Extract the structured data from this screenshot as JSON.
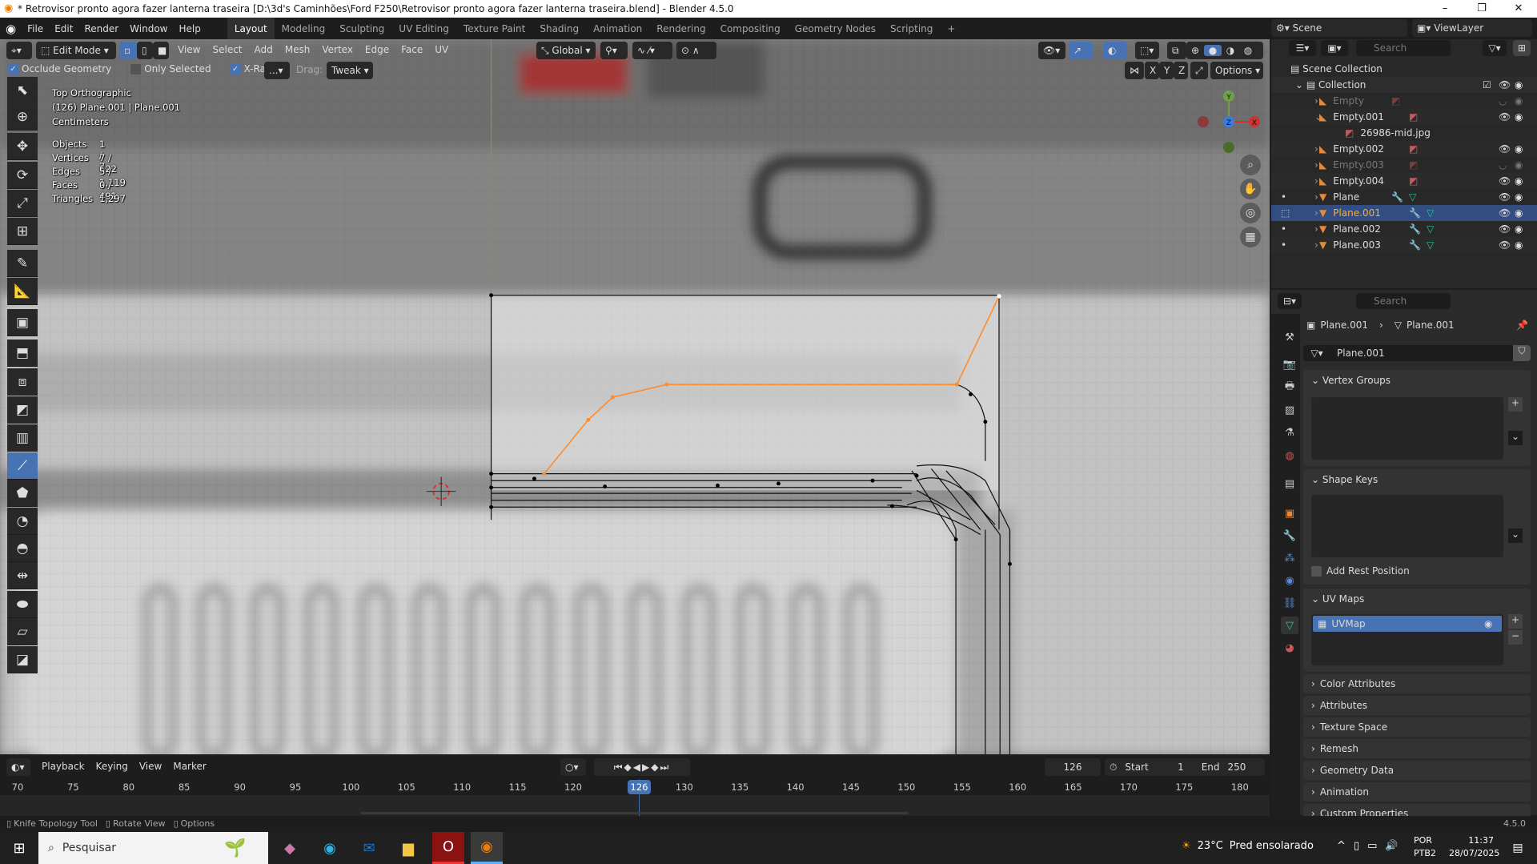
{
  "window": {
    "title": "* Retrovisor pronto agora fazer lanterna traseira [D:\\3d's Caminhões\\Ford F250\\Retrovisor pronto agora fazer lanterna traseira.blend] - Blender 4.5.0",
    "minimize": "–",
    "maximize": "❐",
    "close": "✕"
  },
  "menu": [
    "File",
    "Edit",
    "Render",
    "Window",
    "Help"
  ],
  "workspaces": [
    "Layout",
    "Modeling",
    "Sculpting",
    "UV Editing",
    "Texture Paint",
    "Shading",
    "Animation",
    "Rendering",
    "Compositing",
    "Geometry Nodes",
    "Scripting",
    "+"
  ],
  "active_workspace": "Layout",
  "scene": {
    "name": "Scene",
    "view_layer": "ViewLayer"
  },
  "viewport": {
    "mode": "Edit Mode",
    "menus": [
      "View",
      "Select",
      "Add",
      "Mesh",
      "Vertex",
      "Edge",
      "Face",
      "UV"
    ],
    "orientation": "Global",
    "options": {
      "occlude_geometry": "Occlude Geometry",
      "occlude_checked": true,
      "only_selected": "Only Selected",
      "only_selected_checked": false,
      "xray": "X-Ray",
      "xray_checked": true,
      "more": "...",
      "drag_label": "Drag:",
      "drag_value": "Tweak"
    },
    "mirror_axes": [
      "X",
      "Y",
      "Z"
    ],
    "options_btn": "Options",
    "overlay": {
      "view": "Top Orthographic",
      "object": "(126) Plane.001 | Plane.001",
      "units": "Centimeters"
    },
    "stats": [
      {
        "label": "Objects",
        "value": "1 / 7"
      },
      {
        "label": "Vertices",
        "value": "7 / 622"
      },
      {
        "label": "Edges",
        "value": "5 / 1,119"
      },
      {
        "label": "Faces",
        "value": "0 / 491"
      },
      {
        "label": "Triangles",
        "value": "1,297"
      }
    ],
    "gizmo": {
      "y": "Y",
      "x": "X",
      "z": "Z"
    },
    "accent": "#4772b3",
    "edge_selected": "#ff8c2a"
  },
  "tools": [
    "select-box",
    "cursor",
    "move",
    "rotate",
    "scale",
    "transform",
    "annotate",
    "measure",
    "add-cube",
    "extrude",
    "inset",
    "bevel",
    "loop-cut",
    "knife",
    "poly-build",
    "spin",
    "smooth",
    "edge-slide",
    "shrink-fatten",
    "shear",
    "rip"
  ],
  "active_tool": "knife",
  "outliner": {
    "search_placeholder": "Search",
    "scene_collection": "Scene Collection",
    "collection": "Collection",
    "items": [
      {
        "name": "Empty",
        "type": "empty",
        "hidden": true
      },
      {
        "name": "Empty.001",
        "type": "empty",
        "expanded": true
      },
      {
        "name": "26986-mid.jpg",
        "type": "image",
        "child": true
      },
      {
        "name": "Empty.002",
        "type": "empty"
      },
      {
        "name": "Empty.003",
        "type": "empty",
        "hidden": true
      },
      {
        "name": "Empty.004",
        "type": "empty"
      },
      {
        "name": "Plane",
        "type": "mesh"
      },
      {
        "name": "Plane.001",
        "type": "mesh",
        "selected": true
      },
      {
        "name": "Plane.002",
        "type": "mesh"
      },
      {
        "name": "Plane.003",
        "type": "mesh"
      }
    ]
  },
  "properties": {
    "search_placeholder": "Search",
    "breadcrumb": [
      "Plane.001",
      "Plane.001"
    ],
    "datablock": "Plane.001",
    "vertex_groups": "Vertex Groups",
    "shape_keys": "Shape Keys",
    "add_rest_position": "Add Rest Position",
    "uv_maps": "UV Maps",
    "uv_map_item": "UVMap",
    "collapsed": [
      "Color Attributes",
      "Attributes",
      "Texture Space",
      "Remesh",
      "Geometry Data",
      "Animation",
      "Custom Properties"
    ]
  },
  "timeline": {
    "menus": [
      "Playback",
      "Keying",
      "View",
      "Marker"
    ],
    "current_frame": "126",
    "start_label": "Start",
    "start": "1",
    "end_label": "End",
    "end": "250",
    "ticks": [
      "70",
      "75",
      "80",
      "85",
      "90",
      "95",
      "100",
      "105",
      "110",
      "115",
      "120",
      "",
      "130",
      "135",
      "140",
      "145",
      "150",
      "155",
      "160",
      "165",
      "170",
      "175",
      "180"
    ]
  },
  "status": {
    "items": [
      "Knife Topology Tool",
      "Rotate View",
      "Options"
    ],
    "version": "4.5.0"
  },
  "taskbar": {
    "search": "Pesquisar",
    "weather_temp": "23°C",
    "weather_text": "Pred ensolarado",
    "lang1": "POR",
    "lang2": "PTB2",
    "time": "11:37",
    "date": "28/07/2025"
  }
}
